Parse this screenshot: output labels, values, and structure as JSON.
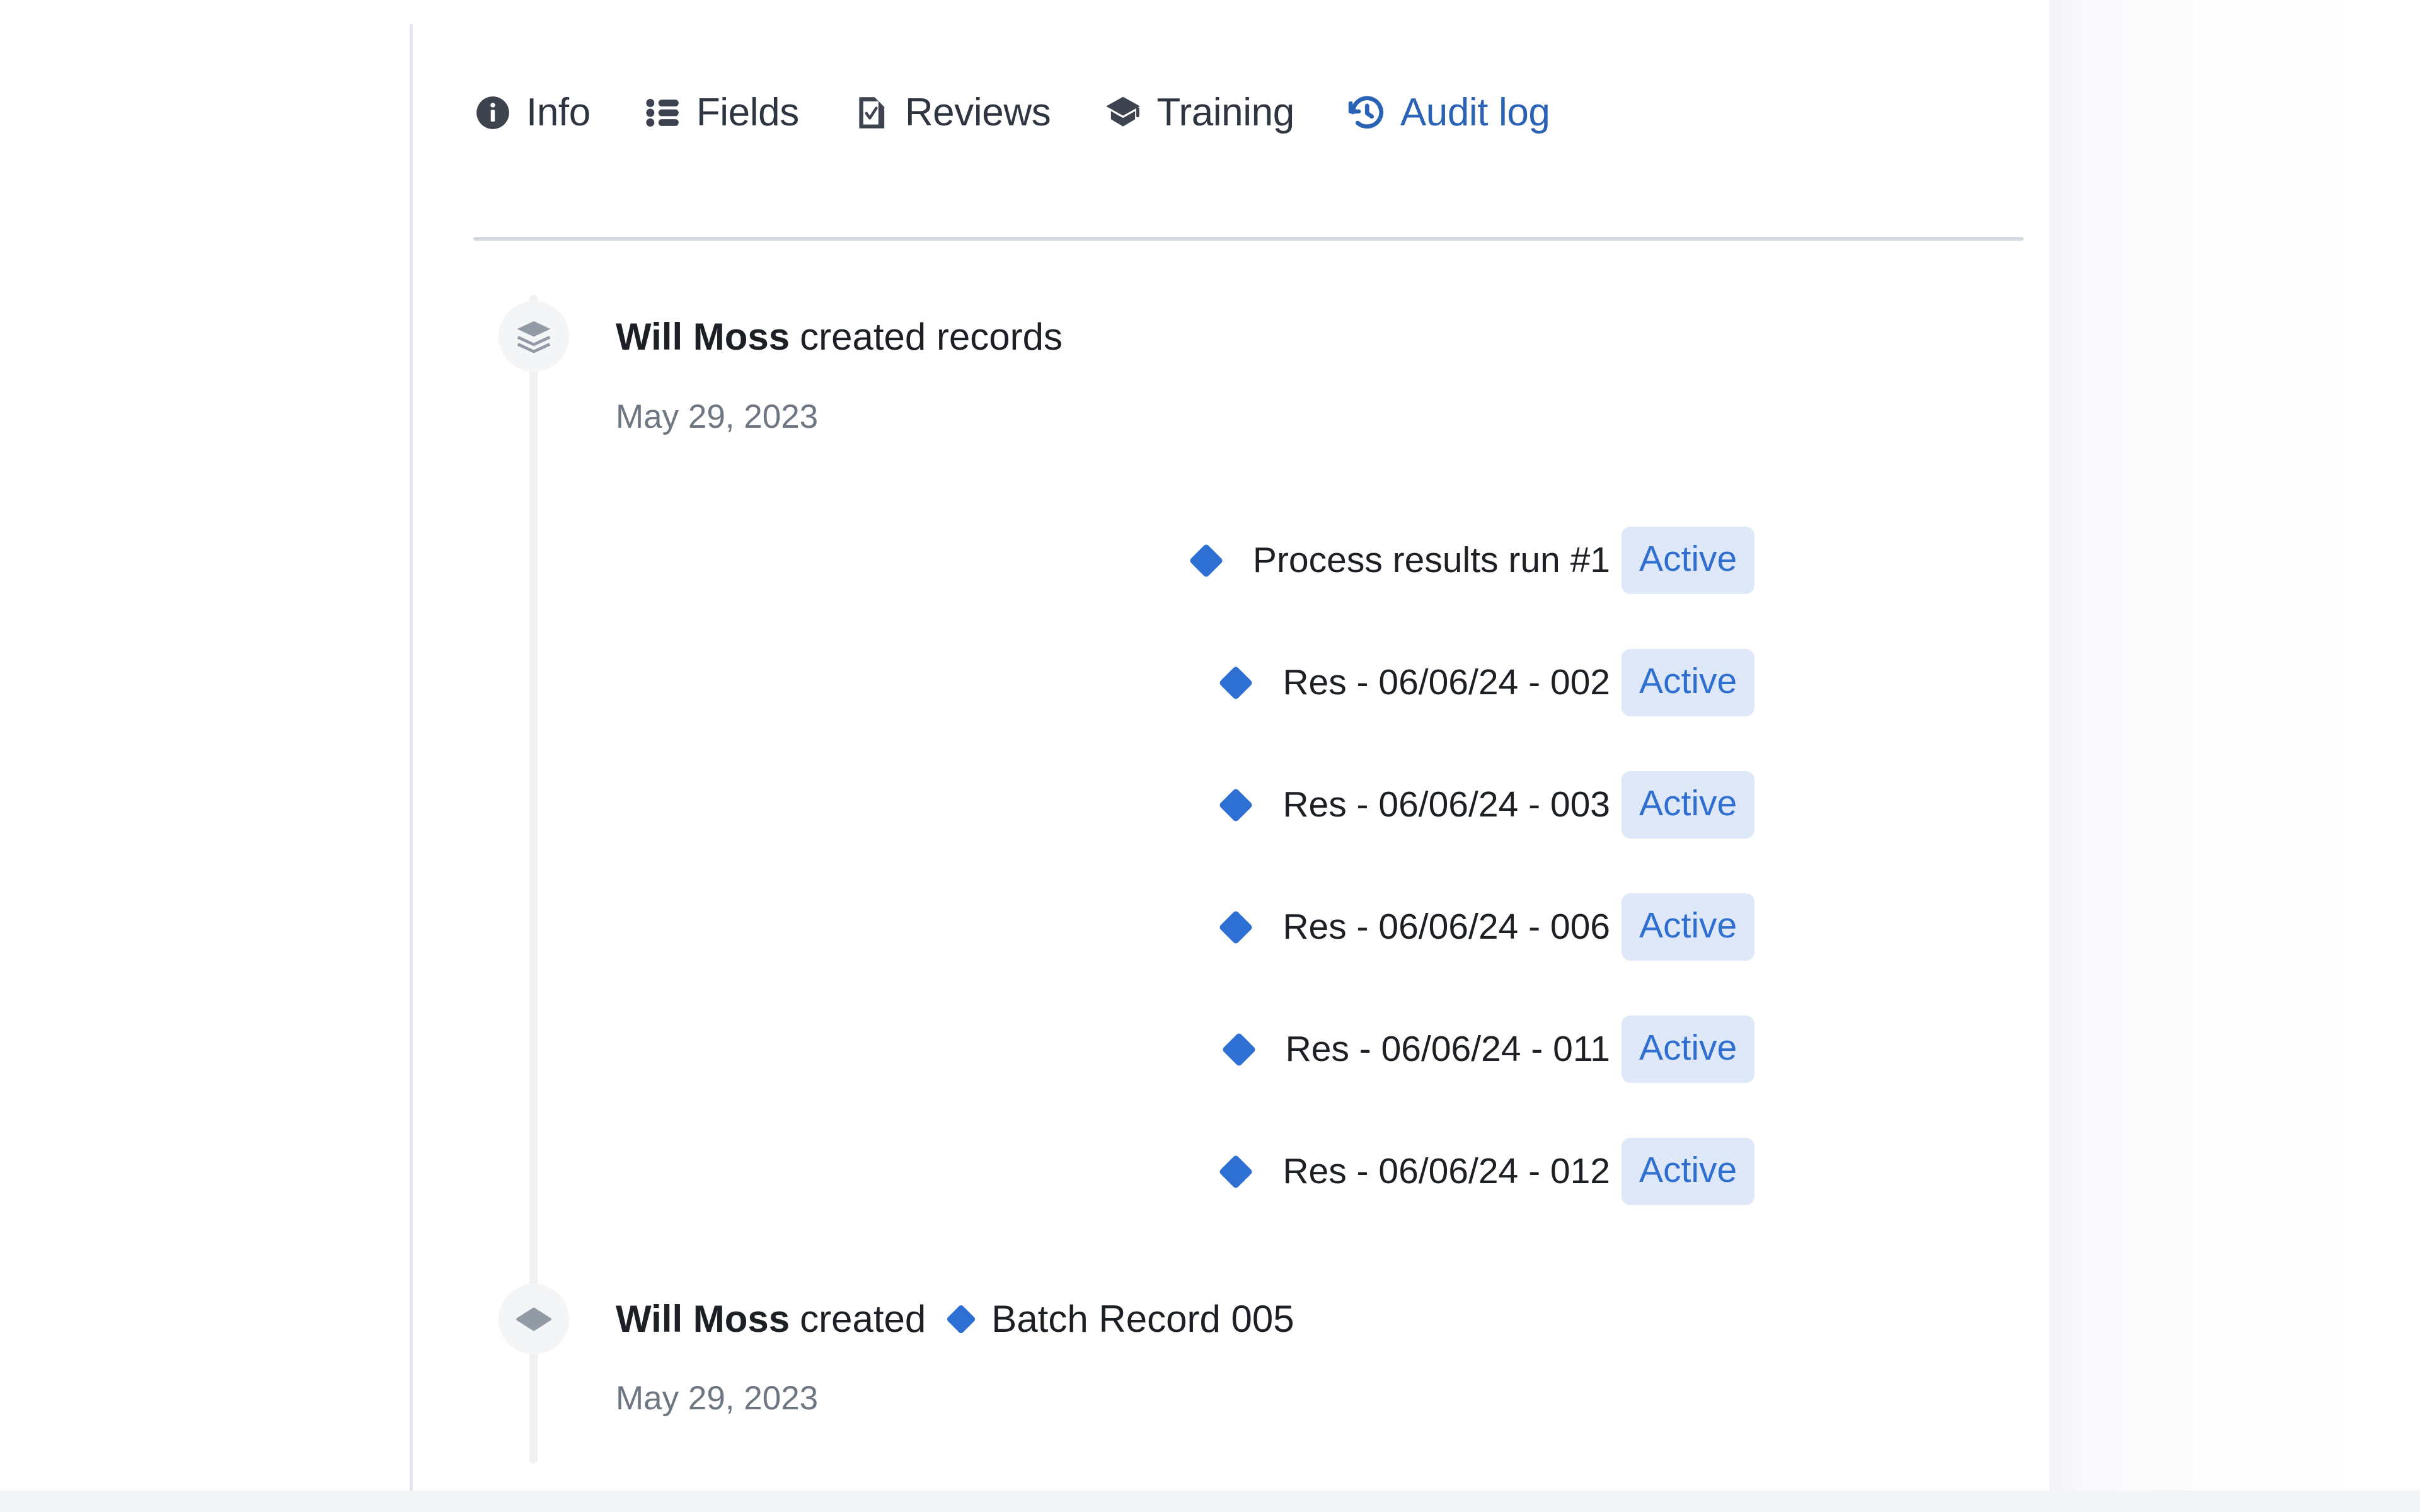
{
  "colors": {
    "accent_blue": "#2a62b5",
    "record_blue": "#2e6fd4",
    "badge_bg": "#dfe8f8",
    "badge_text": "#2f6fd0",
    "tab_text": "#2e3440",
    "muted_text": "#6e7682",
    "rail": "#f0f1f3",
    "panel_border": "#e4e7ec",
    "divider": "#d5dae1"
  },
  "tabs": [
    {
      "label": "Info",
      "icon": "info-circle-icon",
      "active": false
    },
    {
      "label": "Fields",
      "icon": "list-bullet-icon",
      "active": false
    },
    {
      "label": "Reviews",
      "icon": "document-check-icon",
      "active": false
    },
    {
      "label": "Training",
      "icon": "graduation-cap-icon",
      "active": false
    },
    {
      "label": "Audit log",
      "icon": "history-clock-icon",
      "active": true
    }
  ],
  "timeline": {
    "events": [
      {
        "avatar_icon": "layers-stack-icon",
        "actor": "Will Moss",
        "verb": "created records",
        "date": "May 29, 2023",
        "records": [
          {
            "icon": "diamond-icon",
            "label": "Process results run #1",
            "status": "Active"
          },
          {
            "icon": "diamond-icon",
            "label": "Res - 06/06/24 - 002",
            "status": "Active"
          },
          {
            "icon": "diamond-icon",
            "label": "Res - 06/06/24 - 003",
            "status": "Active"
          },
          {
            "icon": "diamond-icon",
            "label": "Res - 06/06/24 - 006",
            "status": "Active"
          },
          {
            "icon": "diamond-icon",
            "label": "Res - 06/06/24 - 011",
            "status": "Active"
          },
          {
            "icon": "diamond-icon",
            "label": "Res - 06/06/24 - 012",
            "status": "Active"
          }
        ]
      },
      {
        "avatar_icon": "diamond-flat-icon",
        "actor": "Will Moss",
        "verb": "created",
        "inline_icon": "diamond-icon",
        "object": "Batch Record 005",
        "date": "May 29, 2023",
        "records": []
      }
    ]
  }
}
